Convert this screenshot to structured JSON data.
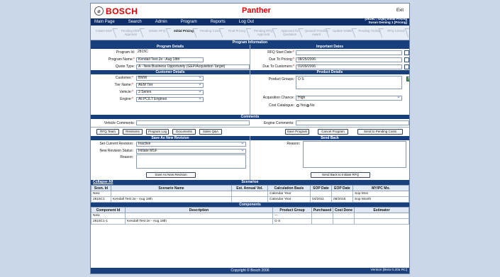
{
  "brand": "BOSCH",
  "app_name": "Panther",
  "exit": "Exit",
  "nav": [
    "Main Page",
    "Search",
    "Admin",
    "Program",
    "Reports",
    "Log Out"
  ],
  "user": [
    "[2815C , GQE] Initial Pricing",
    "Susan Deming 1 [Pricing]"
  ],
  "steps": [
    "Initiate MSF",
    "Pending MSF Approval",
    "Initiate RFQ",
    "Initial Pricing",
    "Pending Costs",
    "Final Pricing",
    "Pending RFQ Approval",
    "Approved for Quotation",
    "Quoted/ Pending Award",
    "Update KIMBA",
    "Pending Tooling",
    "RFQ Closed"
  ],
  "titles": {
    "program_info": "Program Information",
    "program_details": "Program Details",
    "important_dates": "Important Dates",
    "customer_details": "Customer Details",
    "product_details": "Product Details",
    "comments": "Comments",
    "new_revision": "Save As New Revision",
    "send_back": "Send Back",
    "scenarios": "Scenarios",
    "components": "Components"
  },
  "program": {
    "id_label": "Program Id:",
    "id": "2815C",
    "name_label": "Program Name:",
    "name": "Kendall Test 2e - Aug 18th",
    "quote_label": "Quote Type:",
    "quote": "A - New Business Opportunity (GEP/Acquisition Target)"
  },
  "dates": {
    "rfq_label": "RFQ Start Date:",
    "rfq": "",
    "pricing_label": "Due To Pricing:",
    "pricing": "08/25/2006",
    "customers_label": "Due To Customers:",
    "customers": "01/09/2006"
  },
  "customer": {
    "customer_label": "Customer:",
    "customer": "BMW",
    "tier_label": "Tier Name:",
    "tier": "AEM Tier",
    "vehicle_label": "Vehicle:",
    "vehicle": "3 Series",
    "engine_label": "Engine:",
    "engine": "All PC/LT Engines"
  },
  "product": {
    "groups_label": "Product Groups:",
    "groups": "O S",
    "acq_label": "Acquisition Chance:",
    "acq": "High",
    "cost_label": "Cost Catalogue:",
    "yes": "Yes",
    "no": "No"
  },
  "comments": {
    "vehicle_label": "Vehicle Comments:",
    "engine_label": "Engine Comments:"
  },
  "buttons": {
    "rfq_team": "RFQ Team",
    "revisions": "Revisions",
    "program_log": "Program Log",
    "documents": "Documents",
    "sales_qa": "Sales Q&A",
    "save_program": "Save Program",
    "cancel_program": "Cancel Program",
    "send_costs": "Send to Pending Costs",
    "save_revision": "Save As New Revision",
    "send_back": "Send Back to Initiate RFQ"
  },
  "revision": {
    "current_label": "Set Current Revision:",
    "current": "Inactive",
    "status_label": "New Revision Status:",
    "status": "Initiate MSF",
    "reason_label": "Reason:"
  },
  "send_reason_label": "Reason:",
  "collapse": "Collapse All",
  "scenario_headers": [
    "Scen. Id",
    "Scenario Name",
    "Est. Annual Vol.",
    "Calculation Basis",
    "SOP Date",
    "EOP Date",
    "MY/PC Mo."
  ],
  "scenario_rows": [
    [
      "New",
      "",
      "",
      "Calendar Year",
      "",
      "",
      "Sop Mon"
    ],
    [
      "2815C1",
      "Kendall Test 2e - Aug 18th",
      "",
      "Calendar Year",
      "04/2011",
      "08/2016",
      "Sop Month"
    ]
  ],
  "component_headers": [
    "Component Id",
    "Description",
    "Product Group",
    "Purchased",
    "Cost Done",
    "Estimator"
  ],
  "component_rows": [
    [
      "New",
      "",
      "---",
      "",
      "",
      ""
    ],
    [
      "2815C1-1",
      "Kendall Test 2e - Aug 18th",
      "O S",
      "",
      "",
      ""
    ]
  ],
  "footer": "Copyright © Bosch 2006",
  "version": "Version [Beta 0.20a RC]"
}
